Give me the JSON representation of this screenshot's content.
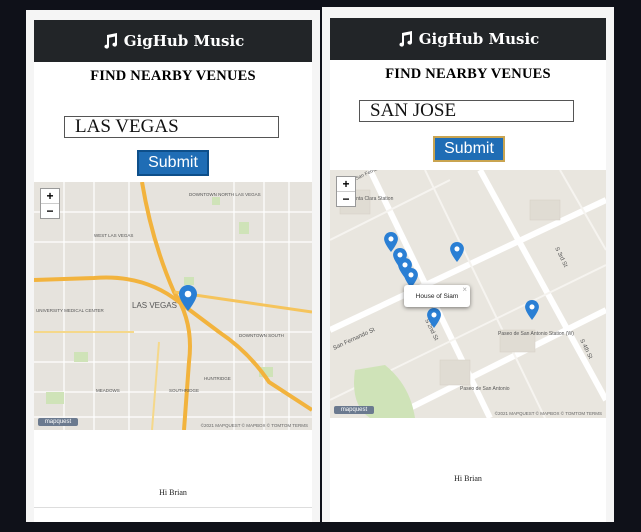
{
  "left": {
    "nav": {
      "title": "GigHub Music"
    },
    "heading": "FIND NEARBY VENUES",
    "input": {
      "value": "LAS VEGAS"
    },
    "submit_label": "Submit",
    "zoom": {
      "in": "+",
      "out": "−"
    },
    "map": {
      "labels": [
        "LAS VEGAS",
        "DOWNTOWN NORTH LAS VEGAS",
        "DOWNTOWN SOUTH",
        "HUNTRIDGE",
        "SOUTHRIDGE",
        "UNIVERSITY MEDICAL CENTER",
        "MEADOWS",
        "WEST LAS VEGAS"
      ],
      "logo": "mapquest",
      "attribution": "©2021 MAPQUEST © MAPBOX © TOMTOM TERMS"
    },
    "footer": {
      "text": "Hi Brian"
    }
  },
  "right": {
    "nav": {
      "title": "GigHub Music"
    },
    "heading": "FIND NEARBY VENUES",
    "input": {
      "value": "SAN JOSE"
    },
    "submit_label": "Submit",
    "zoom": {
      "in": "+",
      "out": "−"
    },
    "map": {
      "popup": "House of Siam",
      "labels": [
        "San Fernando St",
        "S 2nd St",
        "S 3rd St",
        "S 4th St",
        "Paseo de San Antonio Station (W)",
        "Paseo de San Antonio",
        "Santa Clara Station",
        "E San Fernando St"
      ],
      "logo": "mapquest",
      "attribution": "©2021 MAPQUEST © MAPBOX © TOMTOM TERMS"
    },
    "footer": {
      "text": "Hi Brian"
    }
  },
  "colors": {
    "navbar": "#222528",
    "button": "#1f6db5",
    "pin": "#2a7fd4",
    "highway": "#f2b33d"
  }
}
